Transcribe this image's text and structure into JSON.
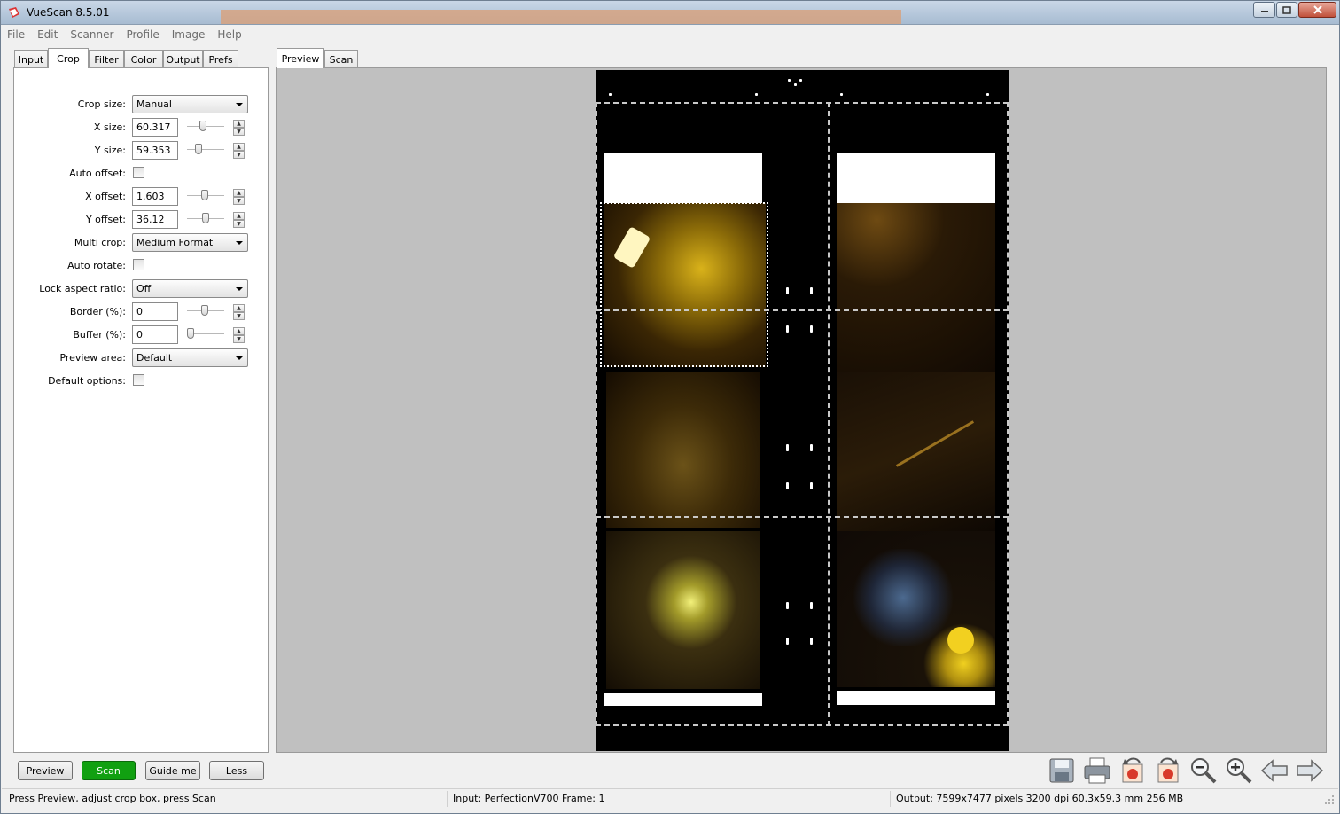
{
  "window": {
    "title": "VueScan 8.5.01"
  },
  "menu": [
    "File",
    "Edit",
    "Scanner",
    "Profile",
    "Image",
    "Help"
  ],
  "left_tabs": [
    {
      "label": "Input",
      "active": false
    },
    {
      "label": "Crop",
      "active": true
    },
    {
      "label": "Filter",
      "active": false
    },
    {
      "label": "Color",
      "active": false
    },
    {
      "label": "Output",
      "active": false
    },
    {
      "label": "Prefs",
      "active": false
    }
  ],
  "right_tabs": [
    {
      "label": "Preview",
      "active": true
    },
    {
      "label": "Scan",
      "active": false
    }
  ],
  "crop": {
    "crop_size": {
      "label": "Crop size:",
      "value": "Manual"
    },
    "x_size": {
      "label": "X size:",
      "value": "60.317",
      "slider": 0.45
    },
    "y_size": {
      "label": "Y size:",
      "value": "59.353",
      "slider": 0.3
    },
    "auto_offset": {
      "label": "Auto offset:",
      "checked": false
    },
    "x_offset": {
      "label": "X offset:",
      "value": "1.603",
      "slider": 0.45
    },
    "y_offset": {
      "label": "Y offset:",
      "value": "36.12",
      "slider": 0.45
    },
    "multi_crop": {
      "label": "Multi crop:",
      "value": "Medium Format"
    },
    "auto_rotate": {
      "label": "Auto rotate:",
      "checked": false
    },
    "lock_aspect": {
      "label": "Lock aspect ratio:",
      "value": "Off"
    },
    "border": {
      "label": "Border (%):",
      "value": "0",
      "slider": 0.45
    },
    "buffer": {
      "label": "Buffer (%):",
      "value": "0",
      "slider": 0.0
    },
    "preview_area": {
      "label": "Preview area:",
      "value": "Default"
    },
    "default_options": {
      "label": "Default options:",
      "checked": false
    }
  },
  "buttons": {
    "preview": "Preview",
    "scan": "Scan",
    "guide": "Guide me",
    "less": "Less"
  },
  "toolbar_icons": [
    "save-icon",
    "print-icon",
    "rotate-left-icon",
    "rotate-right-icon",
    "zoom-out-icon",
    "zoom-in-icon",
    "previous-arrow-icon",
    "next-arrow-icon"
  ],
  "status": {
    "hint": "Press Preview, adjust crop box, press Scan",
    "input": "Input: PerfectionV700 Frame: 1",
    "output": "Output: 7599x7477 pixels 3200 dpi 60.3x59.3 mm 256 MB"
  },
  "colors": {
    "scan_button": "#11a011",
    "preview_bg": "#c0c0c0",
    "film_bg": "#000000"
  }
}
